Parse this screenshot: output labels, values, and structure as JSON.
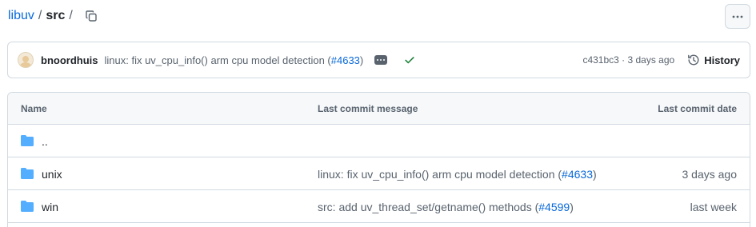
{
  "breadcrumb": {
    "repo": "libuv",
    "separator": "/",
    "current": "src",
    "trailing": "/"
  },
  "latest_commit": {
    "author": "bnoordhuis",
    "message": "linux: fix uv_cpu_info() arm cpu model detection (",
    "pr": "#4633",
    "message_end": ")",
    "sha_time": "c431bc3 · 3 days ago",
    "history_label": "History"
  },
  "table": {
    "columns": [
      "Name",
      "Last commit message",
      "Last commit date"
    ],
    "parent_row": {
      "name": ".."
    },
    "rows": [
      {
        "name": "unix",
        "message": "linux: fix uv_cpu_info() arm cpu model detection (",
        "pr": "#4633",
        "message_end": ")",
        "date": "3 days ago"
      },
      {
        "name": "win",
        "message": "src: add uv_thread_set/getname() methods (",
        "pr": "#4599",
        "message_end": ")",
        "date": "last week"
      }
    ]
  },
  "colors": {
    "link": "#0969da",
    "folder": "#54aeff",
    "success": "#1a7f37",
    "muted": "#59636e",
    "border": "#d1d9e0"
  },
  "icons": [
    "copy-icon",
    "kebab-horizontal-icon",
    "ellipsis-icon",
    "check-icon",
    "history-icon",
    "folder-icon"
  ]
}
